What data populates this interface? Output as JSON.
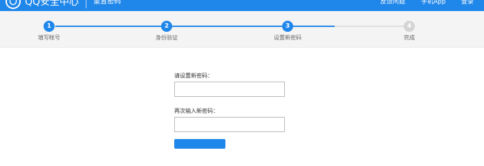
{
  "header": {
    "brand": "QQ安全中心",
    "subtitle": "重置密码",
    "links": [
      "反馈问题",
      "手机App",
      "登录"
    ]
  },
  "steps": [
    {
      "number": "1",
      "label": "填写帐号",
      "state": "done"
    },
    {
      "number": "2",
      "label": "身份验证",
      "state": "done"
    },
    {
      "number": "3",
      "label": "设置新密码",
      "state": "current"
    },
    {
      "number": "4",
      "label": "完成",
      "state": "pending"
    }
  ],
  "form": {
    "new_password_label": "请设置新密码：",
    "new_password_value": "",
    "confirm_password_label": "再次输入新密码：",
    "confirm_password_value": ""
  },
  "colors": {
    "brand_blue": "#1f86ea",
    "step_inactive": "#d4d4d4",
    "steps_bg": "#f4f4f4"
  }
}
